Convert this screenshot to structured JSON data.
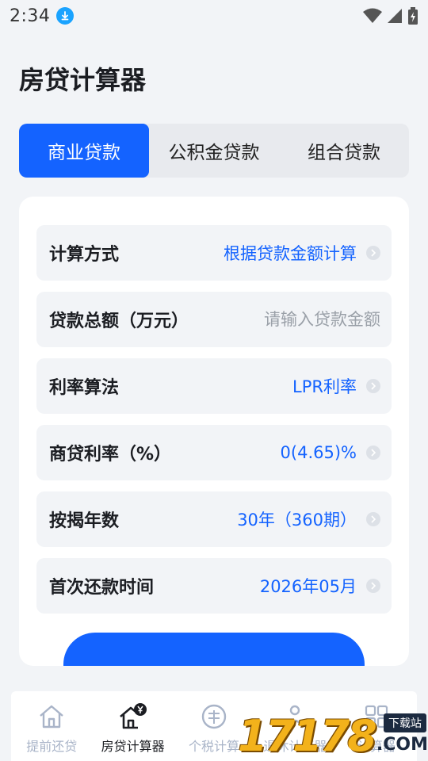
{
  "status_bar": {
    "time": "2:34"
  },
  "page": {
    "title": "房贷计算器"
  },
  "tabs": [
    {
      "label": "商业贷款",
      "active": true
    },
    {
      "label": "公积金贷款",
      "active": false
    },
    {
      "label": "组合贷款",
      "active": false
    }
  ],
  "form": {
    "calc_method": {
      "label": "计算方式",
      "value": "根据贷款金额计算"
    },
    "loan_amount": {
      "label": "贷款总额（万元）",
      "placeholder": "请输入贷款金额",
      "value": ""
    },
    "rate_method": {
      "label": "利率算法",
      "value": "LPR利率"
    },
    "commercial_rate": {
      "label": "商贷利率（%）",
      "value": "0(4.65)%"
    },
    "mortgage_years": {
      "label": "按揭年数",
      "value": "30年（360期）"
    },
    "first_repay": {
      "label": "首次还款时间",
      "value": "2026年05月"
    }
  },
  "bottom_nav": [
    {
      "label": "提前还贷",
      "icon": "house-icon",
      "active": false
    },
    {
      "label": "房贷计算器",
      "icon": "house-yen-icon",
      "active": true
    },
    {
      "label": "个税计算",
      "icon": "tax-icon",
      "active": false
    },
    {
      "label": "退休计算器",
      "icon": "retirement-icon",
      "active": false
    },
    {
      "label": "计算器",
      "icon": "calculator-icon",
      "active": false
    }
  ],
  "watermark": {
    "digits": "17178",
    "suffix": ".COM",
    "tag": "下载站"
  },
  "colors": {
    "accent": "#1463ff",
    "background": "#f2f4f7",
    "nav_inactive": "#a9b4c8"
  }
}
